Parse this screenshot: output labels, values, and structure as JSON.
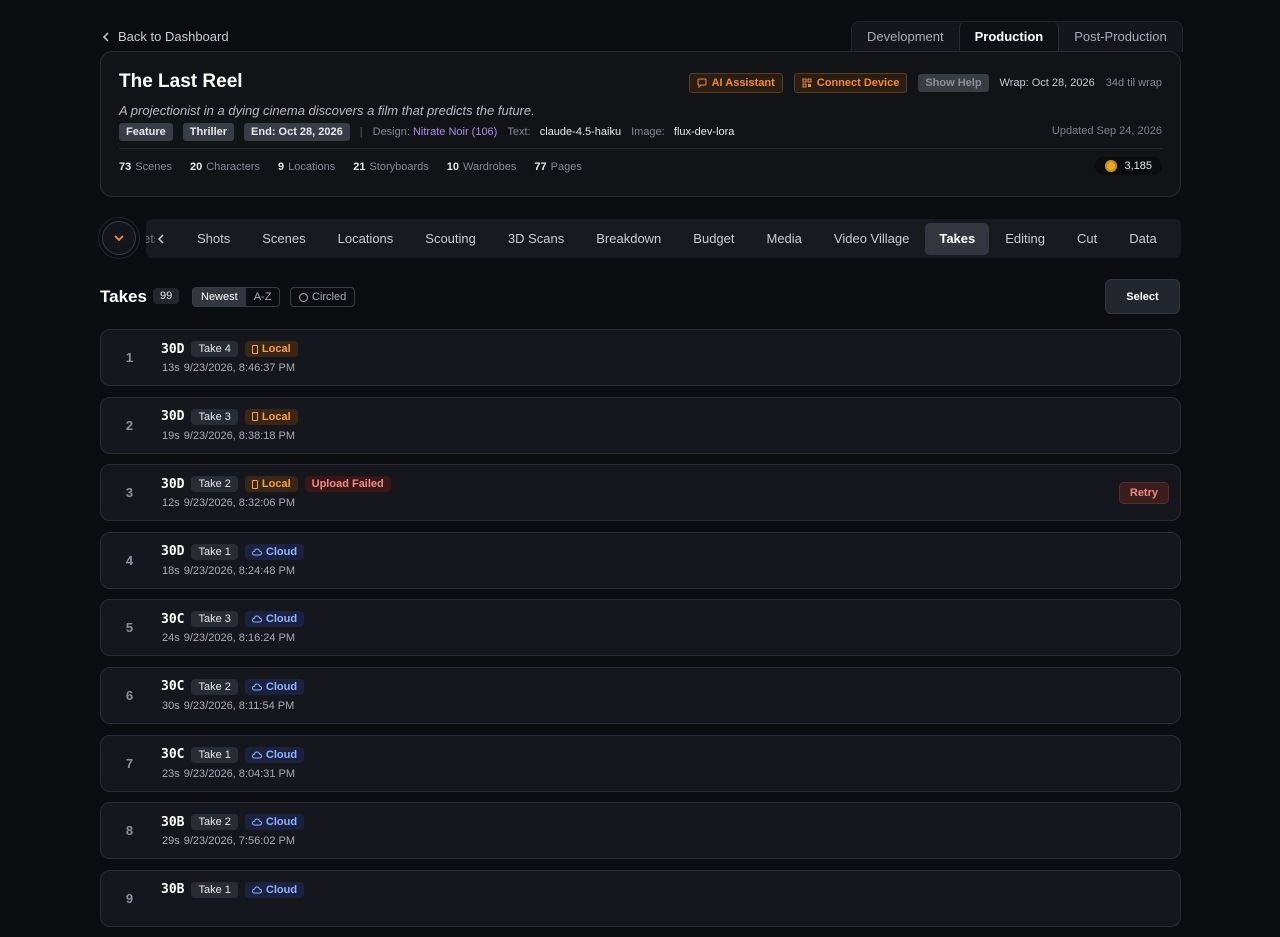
{
  "back_label": "Back to Dashboard",
  "phase_tabs": [
    "Development",
    "Production",
    "Post-Production"
  ],
  "project": {
    "title": "The Last Reel",
    "logline": "A projectionist in a dying cinema discovers a film that predicts the future.",
    "tags": [
      "Feature",
      "Thriller",
      "End: Oct 28, 2026"
    ],
    "design_label": "Design:",
    "design_value": "Nitrate Noir (106)",
    "text_label": "Text:",
    "text_value": "claude-4.5-haiku",
    "image_label": "Image:",
    "image_value": "flux-dev-lora",
    "ai_assistant": "AI Assistant",
    "connect_device": "Connect Device",
    "show_help": "Show Help",
    "wrap": "Wrap: Oct 28, 2026",
    "til_wrap": "34d til wrap",
    "updated": "Updated Sep 24, 2026",
    "coins": "3,185",
    "stats": [
      {
        "n": "73",
        "label": "Scenes"
      },
      {
        "n": "20",
        "label": "Characters"
      },
      {
        "n": "9",
        "label": "Locations"
      },
      {
        "n": "21",
        "label": "Storyboards"
      },
      {
        "n": "10",
        "label": "Wardrobes"
      },
      {
        "n": "77",
        "label": "Pages"
      }
    ]
  },
  "nav": {
    "ghost": "ets",
    "items": [
      "Shots",
      "Scenes",
      "Locations",
      "Scouting",
      "3D Scans",
      "Breakdown",
      "Budget",
      "Media",
      "Video Village",
      "Takes",
      "Editing",
      "Cut",
      "Data"
    ],
    "active": "Takes"
  },
  "takes": {
    "title": "Takes",
    "count": "99",
    "sort_newest": "Newest",
    "sort_az": "A-Z",
    "circled": "Circled",
    "select": "Select",
    "retry": "Retry",
    "rows": [
      {
        "num": "1",
        "scene": "30D",
        "take": "Take 4",
        "storage": "Local",
        "failed": "",
        "dur": "13s",
        "ts": "9/23/2026, 8:46:37 PM"
      },
      {
        "num": "2",
        "scene": "30D",
        "take": "Take 3",
        "storage": "Local",
        "failed": "",
        "dur": "19s",
        "ts": "9/23/2026, 8:38:18 PM"
      },
      {
        "num": "3",
        "scene": "30D",
        "take": "Take 2",
        "storage": "Local",
        "failed": "Upload Failed",
        "dur": "12s",
        "ts": "9/23/2026, 8:32:06 PM"
      },
      {
        "num": "4",
        "scene": "30D",
        "take": "Take 1",
        "storage": "Cloud",
        "failed": "",
        "dur": "18s",
        "ts": "9/23/2026, 8:24:48 PM"
      },
      {
        "num": "5",
        "scene": "30C",
        "take": "Take 3",
        "storage": "Cloud",
        "failed": "",
        "dur": "24s",
        "ts": "9/23/2026, 8:16:24 PM"
      },
      {
        "num": "6",
        "scene": "30C",
        "take": "Take 2",
        "storage": "Cloud",
        "failed": "",
        "dur": "30s",
        "ts": "9/23/2026, 8:11:54 PM"
      },
      {
        "num": "7",
        "scene": "30C",
        "take": "Take 1",
        "storage": "Cloud",
        "failed": "",
        "dur": "23s",
        "ts": "9/23/2026, 8:04:31 PM"
      },
      {
        "num": "8",
        "scene": "30B",
        "take": "Take 2",
        "storage": "Cloud",
        "failed": "",
        "dur": "29s",
        "ts": "9/23/2026, 7:56:02 PM"
      },
      {
        "num": "9",
        "scene": "30B",
        "take": "Take 1",
        "storage": "Cloud",
        "failed": "",
        "dur": "",
        "ts": ""
      }
    ]
  }
}
